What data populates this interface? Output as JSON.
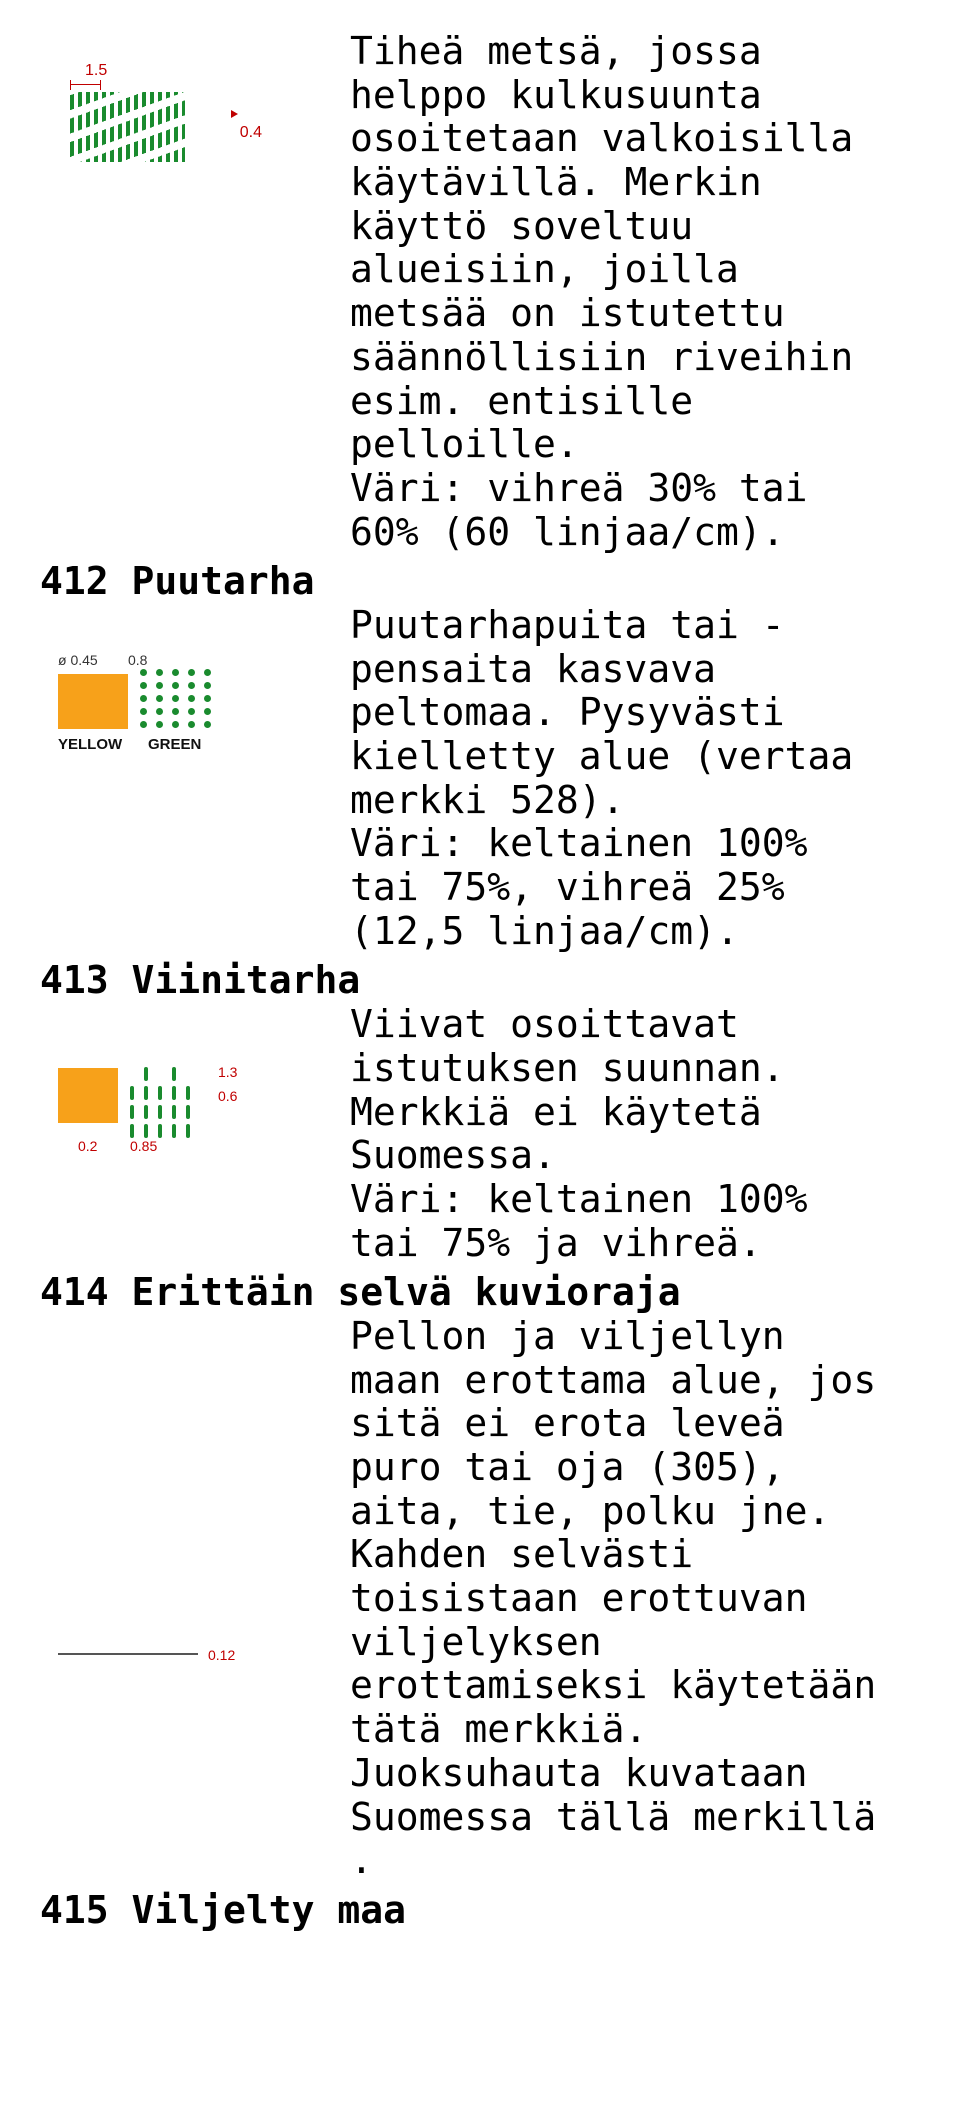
{
  "s411": {
    "desc": "Tiheä metsä, jossa\nhelppo kulkusuunta\nosoitetaan valkoisilla\nkäytävillä. Merkin\nkäyttö soveltuu\nalueisiin, joilla\nmetsää on istutettu\nsäännöllisiin riveihin\nesim. entisille\npelloille.\nVäri: vihreä 30% tai\n60% (60 linjaa/cm).",
    "dim15": "1.5",
    "dim04": "0.4"
  },
  "s412": {
    "heading": "412 Puutarha",
    "desc": "Puutarhapuita tai -\npensaita kasvava\npeltomaa. Pysyvästi\nkielletty alue (vertaa\nmerkki 528).\nVäri: keltainen 100%\ntai 75%, vihreä 25%\n(12,5 linjaa/cm).",
    "d045": "ø 0.45",
    "d08": "0.8",
    "labYellow": "YELLOW",
    "labGreen": "GREEN"
  },
  "s413": {
    "heading": "413 Viinitarha",
    "desc": "Viivat osoittavat\nistutuksen suunnan.\nMerkkiä ei käytetä\nSuomessa.\nVäri: keltainen 100%\ntai 75% ja vihreä.",
    "d13": "1.3",
    "d06": "0.6",
    "d02": "0.2",
    "d085": "0.85"
  },
  "s414": {
    "heading": "414 Erittäin selvä kuvioraja",
    "desc": "Pellon ja viljellyn\nmaan erottama alue, jos\nsitä ei erota leveä\npuro tai oja (305),\naita, tie, polku jne.\nKahden selvästi\ntoisistaan erottuvan\nviljelyksen\nerottamiseksi käytetään\ntätä merkkiä.\nJuoksuhauta kuvataan\nSuomessa tällä merkillä\n.",
    "d012": "0.12"
  },
  "s415": {
    "heading": "415 Viljelty maa"
  }
}
